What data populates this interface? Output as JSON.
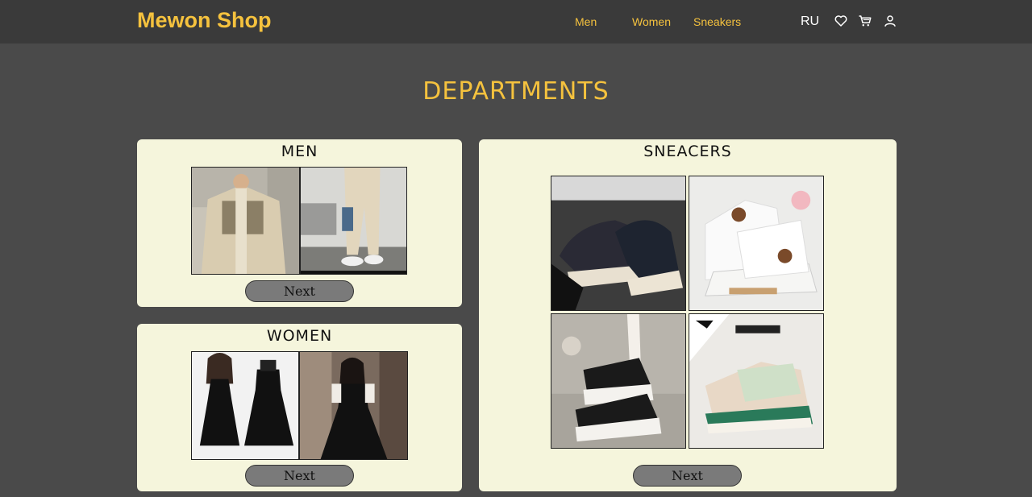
{
  "header": {
    "logo": "Mewon Shop",
    "nav": [
      "Men",
      "Women",
      "Sneakers"
    ],
    "lang": "RU",
    "icons": [
      "heart-icon",
      "cart-icon",
      "user-icon"
    ]
  },
  "page_title": "DEPARTMENTS",
  "departments": {
    "men": {
      "title": "MEN",
      "button": "Next"
    },
    "women": {
      "title": "WOMEN",
      "button": "Next"
    },
    "sneakers": {
      "title": "SNEACERS",
      "button": "Next"
    }
  },
  "colors": {
    "background": "#4a4a4a",
    "header": "#3a3a3a",
    "accent": "#f5c23e",
    "card": "#f5f5dc",
    "button": "#7a7a7a"
  }
}
